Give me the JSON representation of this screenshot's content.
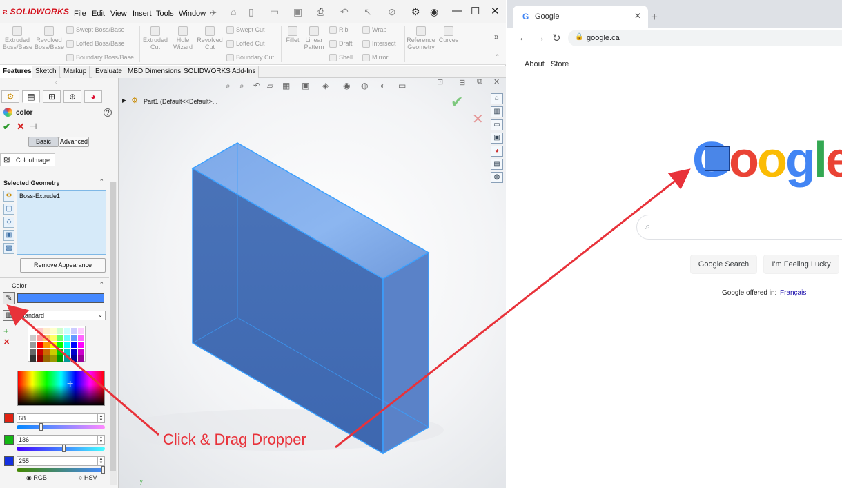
{
  "solidworks": {
    "logo": "SOLIDWORKS",
    "menu": [
      "File",
      "Edit",
      "View",
      "Insert",
      "Tools",
      "Window"
    ],
    "ribbon": {
      "extruded_boss": "Extruded Boss/Base",
      "revolved_boss": "Revolved Boss/Base",
      "swept_boss": "Swept Boss/Base",
      "lofted_boss": "Lofted Boss/Base",
      "boundary_boss": "Boundary Boss/Base",
      "extruded_cut": "Extruded Cut",
      "hole_wizard": "Hole Wizard",
      "revolved_cut": "Revolved Cut",
      "swept_cut": "Swept Cut",
      "lofted_cut": "Lofted Cut",
      "boundary_cut": "Boundary Cut",
      "fillet": "Fillet",
      "linear_pattern": "Linear Pattern",
      "rib": "Rib",
      "draft": "Draft",
      "shell": "Shell",
      "wrap": "Wrap",
      "intersect": "Intersect",
      "mirror": "Mirror",
      "reference_geometry": "Reference Geometry",
      "curves": "Curves"
    },
    "tabs": [
      "Features",
      "Sketch",
      "Markup",
      "Evaluate",
      "MBD Dimensions",
      "SOLIDWORKS Add-Ins"
    ],
    "active_tab": "Features",
    "property_manager": {
      "title": "color",
      "mode_basic": "Basic",
      "mode_advanced": "Advanced",
      "subtab": "Color/Image",
      "selected_geometry_label": "Selected Geometry",
      "selected_item": "Boss-Extrude1",
      "remove_appearance": "Remove Appearance",
      "color_label": "Color",
      "current_color": "#4488ff",
      "palette": "standard",
      "red_value": "68",
      "green_value": "136",
      "blue_value": "255",
      "rgb_label": "RGB",
      "hsv_label": "HSV",
      "red_fraction": 0.267,
      "green_fraction": 0.533,
      "blue_fraction": 1.0
    },
    "tree_root": "Part1  (Default<<Default>...",
    "model_color": "#3f6fc4"
  },
  "chrome": {
    "tab_title": "Google",
    "url": "google.ca",
    "links": {
      "about": "About",
      "store": "Store"
    },
    "search_button": "Google Search",
    "lucky_button": "I'm Feeling Lucky",
    "offered_in": "Google offered in:",
    "language_link": "Français",
    "logo_letters": [
      "G",
      "o",
      "o",
      "g",
      "l",
      "e"
    ],
    "logo_colors": [
      "#4285f4",
      "#ea4335",
      "#fbbc05",
      "#4285f4",
      "#34a853",
      "#ea4335"
    ]
  },
  "annotation": {
    "label": "Click & Drag Dropper",
    "color": "#e8323a"
  }
}
